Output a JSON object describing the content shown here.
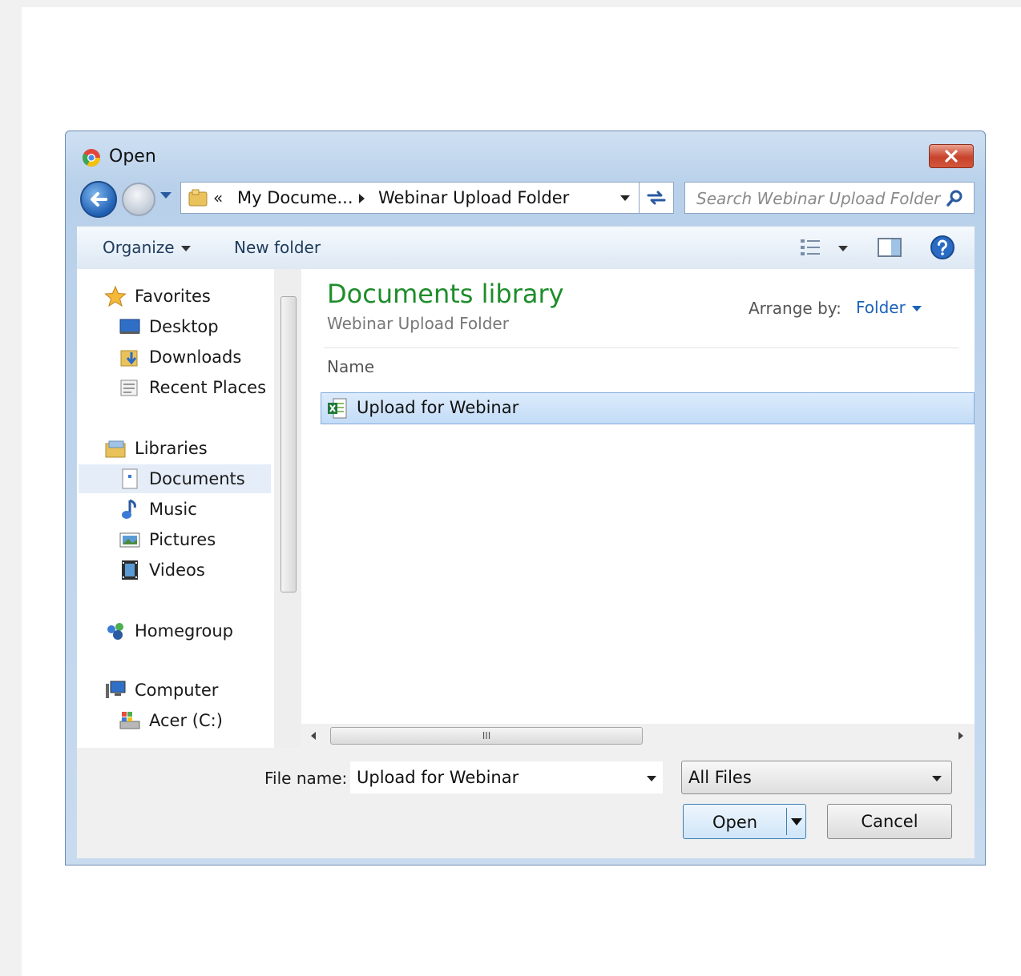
{
  "window": {
    "title": "Open"
  },
  "address_bar": {
    "overflow_chevron": "«",
    "crumbs": [
      "My Docume...",
      "Webinar Upload Folder"
    ]
  },
  "search": {
    "placeholder": "Search Webinar Upload Folder"
  },
  "toolbar": {
    "organize_label": "Organize",
    "new_folder_label": "New folder"
  },
  "nav_pane": {
    "favorites": {
      "label": "Favorites",
      "items": [
        "Desktop",
        "Downloads",
        "Recent Places"
      ]
    },
    "libraries": {
      "label": "Libraries",
      "items": [
        "Documents",
        "Music",
        "Pictures",
        "Videos"
      ],
      "selected": "Documents"
    },
    "homegroup": {
      "label": "Homegroup"
    },
    "computer": {
      "label": "Computer",
      "items": [
        "Acer (C:)"
      ]
    }
  },
  "content": {
    "library_title": "Documents library",
    "library_subtitle": "Webinar Upload Folder",
    "arrange_label": "Arrange by:",
    "arrange_value": "Folder",
    "column_header": "Name",
    "files": [
      {
        "name": "Upload for Webinar",
        "selected": true
      }
    ]
  },
  "scrollbar": {
    "grip": "III"
  },
  "footer": {
    "file_name_label": "File name:",
    "file_name_value": "Upload for Webinar",
    "file_type_value": "All Files",
    "open_label": "Open",
    "cancel_label": "Cancel"
  }
}
